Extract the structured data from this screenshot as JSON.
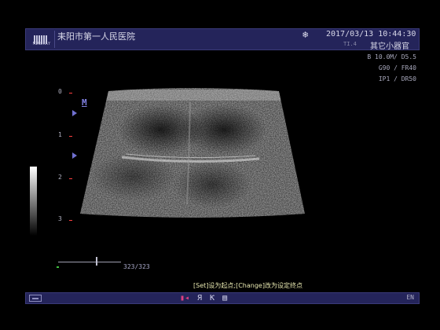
{
  "header": {
    "logo_text": "MINDRAY",
    "hospital_name": "耒阳市第一人民医院",
    "freeze_icon": "snowflake-icon",
    "datetime": "2017/03/13  10:44:30",
    "thermal_index": "TI.4",
    "exam_preset": "其它小器官"
  },
  "params": {
    "line1": "B 10.0M/ D5.5",
    "line2": "G90 / FR40",
    "line3": "IP1 / DR50"
  },
  "depth_scale": {
    "labels": [
      "0",
      "1",
      "2",
      "3"
    ],
    "marker": "M"
  },
  "cine": {
    "frame_counter": "323/323"
  },
  "hint": "[Set]设为起点;[Change]改为设定终点",
  "footer": {
    "icons": [
      "cine-icon",
      "ruler-icon",
      "measure-icon",
      "report-icon"
    ],
    "icon_glyphs": [
      "▮◂",
      "Я",
      "Ƙ",
      "▤"
    ],
    "language": "EN"
  },
  "colors": {
    "bar_bg": "#24245a",
    "accent": "#8080e0"
  }
}
